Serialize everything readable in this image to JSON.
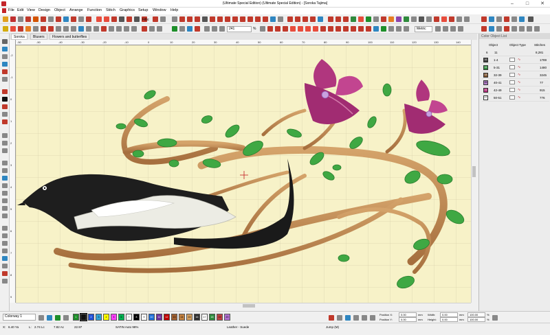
{
  "title": "(Ultimate Special Edition) (Ultimate Special Edition) - [Soroka     Tajima]",
  "menu": [
    "File",
    "Edit",
    "View",
    "Design",
    "Object",
    "Arrange",
    "Function",
    "Stitch",
    "Graphics",
    "Setup",
    "Window",
    "Help"
  ],
  "toolbar": {
    "fills_label": "Fills:",
    "angle_value": "241",
    "percent_label": "%",
    "units_value": "Metric"
  },
  "doc_tabs": [
    "Soroka",
    "Blusers",
    "Flowers and butterflies"
  ],
  "ruler_top_numbers": [
    "-50",
    "-50",
    "-40",
    "-30",
    "-20",
    "-10",
    "0",
    "10",
    "20",
    "30",
    "40",
    "50",
    "60",
    "70",
    "80",
    "90",
    "100",
    "110",
    "120",
    "130",
    "140"
  ],
  "ruler_left_numbers": [
    "-2",
    "-1",
    "0",
    "1",
    "2",
    "3",
    "4",
    "5",
    "6",
    "7",
    "8",
    "9"
  ],
  "color_sequence": {
    "header": "Color Object List",
    "columns": {
      "no": "Object",
      "type": "Object Type",
      "stitches": "Stitches"
    },
    "summary_row": {
      "code": "6",
      "count_a": "11",
      "stitches": "8,281"
    },
    "rows": [
      {
        "num": "16",
        "value": "1-4",
        "stitches": "1789",
        "color": "#3a3a3a"
      },
      {
        "num": "16",
        "value": "5-31",
        "stitches": "1480",
        "color": "#2e8a3c"
      },
      {
        "num": "18",
        "value": "32-39",
        "stitches": "3245",
        "color": "#7a4f2a"
      },
      {
        "num": "26",
        "value": "40-41",
        "stitches": "77",
        "color": "#b27fca"
      },
      {
        "num": "31",
        "value": "42-49",
        "stitches": "915",
        "color": "#b02a78"
      },
      {
        "num": "17",
        "value": "50-51",
        "stitches": "776",
        "color": "#ffffff"
      }
    ]
  },
  "bottom_toolbar": {
    "colorway": "Colorway 1",
    "palette": [
      {
        "n": "1",
        "color": "#1e8f2a"
      },
      {
        "n": "",
        "color": "#111111"
      },
      {
        "n": "2",
        "color": "#1f4fd8"
      },
      {
        "n": "3",
        "color": "#2fa3d8"
      },
      {
        "n": "4",
        "color": "#ffff00"
      },
      {
        "n": "5",
        "color": "#ff40ff"
      },
      {
        "n": "6",
        "color": "#00b050"
      },
      {
        "n": "7",
        "color": "#ffffff"
      },
      {
        "n": "8",
        "color": "#000000"
      },
      {
        "n": "9",
        "color": "#ffffff"
      },
      {
        "n": "10",
        "color": "#1e6fd8"
      },
      {
        "n": "11",
        "color": "#7030a0"
      },
      {
        "n": "12",
        "color": "#c00000"
      },
      {
        "n": "13",
        "color": "#a06030"
      },
      {
        "n": "14",
        "color": "#c08040"
      },
      {
        "n": "15",
        "color": "#d4a060"
      },
      {
        "n": "16",
        "color": "#2f2f2f"
      },
      {
        "n": "17",
        "color": "#ffffff"
      },
      {
        "n": "18",
        "color": "#2e8a3c"
      },
      {
        "n": "19",
        "color": "#c04040"
      },
      {
        "n": "20",
        "color": "#b070d0"
      }
    ],
    "position_x_label": "Position X:",
    "position_y_label": "Position Y:",
    "position_x": "0.00",
    "position_y": "0.00",
    "width_label": "Width:",
    "height_label": "Height:",
    "width": "0.00",
    "height": "0.00",
    "mm": "mm",
    "scale_w": "100.00",
    "scale_h": "100.00",
    "pct": "%"
  },
  "status": {
    "x_label": "X:",
    "x": "6.40 Ya",
    "l_label": "L:",
    "l": "2.74 Lc",
    "l2": "7.82 Ac",
    "angle": "22.97",
    "satin": "SATIN Auto 98%",
    "fabric": "Leather - Suede",
    "jump": "Jump (M)"
  }
}
